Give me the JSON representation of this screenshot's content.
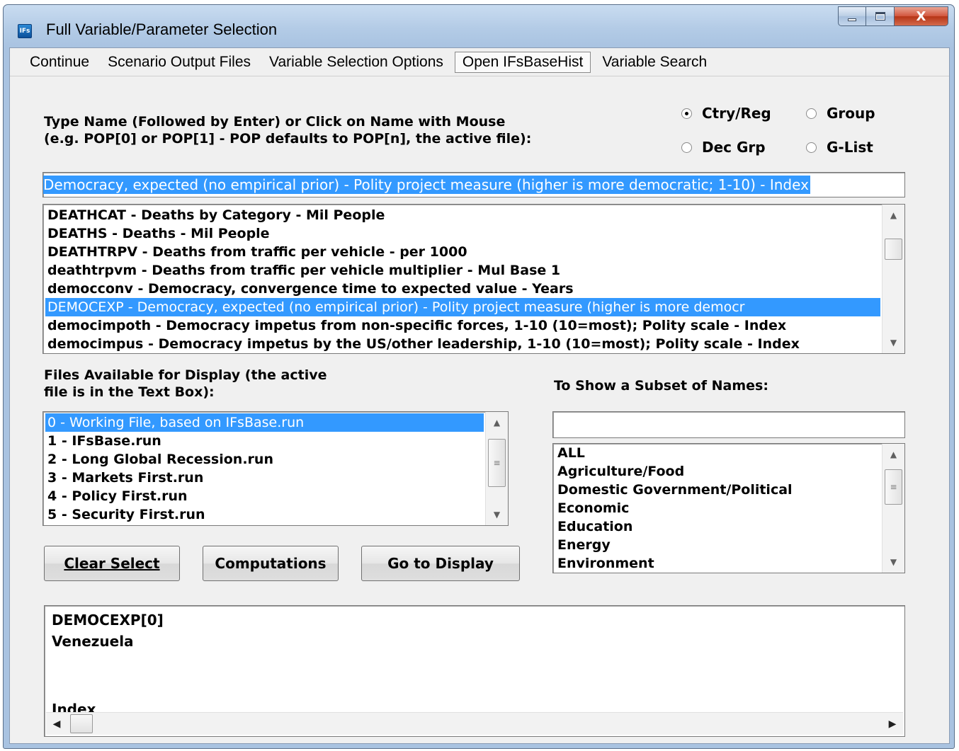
{
  "window": {
    "title": "Full Variable/Parameter Selection",
    "icon_label": "IFs",
    "close_glyph": "X"
  },
  "menu": {
    "items": [
      {
        "label": "Continue",
        "active": false
      },
      {
        "label": "Scenario Output Files",
        "active": false
      },
      {
        "label": "Variable Selection Options",
        "active": false
      },
      {
        "label": "Open IFsBaseHist",
        "active": true
      },
      {
        "label": "Variable Search",
        "active": false
      }
    ]
  },
  "instructions": {
    "line1": "Type Name (Followed by Enter) or Click on Name with Mouse",
    "line2": "(e.g. POP[0] or POP[1] - POP defaults to POP[n], the active file):"
  },
  "radios": {
    "ctry_reg": {
      "label": "Ctry/Reg",
      "checked": true
    },
    "group": {
      "label": "Group",
      "checked": false
    },
    "dec_grp": {
      "label": "Dec Grp",
      "checked": false
    },
    "g_list": {
      "label": "G-List",
      "checked": false
    }
  },
  "variable_input": {
    "value": "Democracy, expected (no empirical prior) - Polity project measure  (higher is more democratic; 1-10) - Index"
  },
  "variables": [
    {
      "text": "DEATHCAT - Deaths by Category - Mil People",
      "selected": false
    },
    {
      "text": "DEATHS - Deaths - Mil People",
      "selected": false
    },
    {
      "text": "DEATHTRPV - Deaths from traffic per vehicle - per 1000",
      "selected": false
    },
    {
      "text": "deathtrpvm - Deaths from traffic per vehicle multiplier - Mul Base 1",
      "selected": false
    },
    {
      "text": "democconv - Democracy, convergence time to expected value - Years",
      "selected": false
    },
    {
      "text": "DEMOCEXP - Democracy, expected (no empirical prior) - Polity project measure  (higher is more democr",
      "selected": true
    },
    {
      "text": "democimpoth - Democracy impetus from non-specific forces, 1-10 (10=most); Polity scale - Index",
      "selected": false
    },
    {
      "text": "democimpus - Democracy impetus by the US/other leadership, 1-10 (10=most); Polity scale - Index",
      "selected": false
    }
  ],
  "files_section": {
    "label_line1": "Files Available for Display (the active",
    "label_line2": "file is in the Text Box):",
    "items": [
      {
        "text": "0 - Working File, based on IFsBase.run",
        "selected": true
      },
      {
        "text": "1 - IFsBase.run",
        "selected": false
      },
      {
        "text": "2 - Long Global Recession.run",
        "selected": false
      },
      {
        "text": "3 - Markets First.run",
        "selected": false
      },
      {
        "text": "4 - Policy First.run",
        "selected": false
      },
      {
        "text": "5 - Security First.run",
        "selected": false
      }
    ]
  },
  "subset_section": {
    "label": "To Show a Subset of Names:",
    "filter_value": "",
    "items": [
      "ALL",
      "Agriculture/Food",
      "Domestic Government/Political",
      "Economic",
      "Education",
      "Energy",
      "Environment"
    ]
  },
  "buttons": {
    "clear_select": "Clear Select",
    "computations": "Computations",
    "go_to_display": "Go to Display"
  },
  "output": {
    "line1": "DEMOCEXP[0]",
    "line2": "Venezuela",
    "line3": "Index"
  },
  "icons": {
    "scroll_up": "▲",
    "scroll_down": "▼",
    "scroll_left": "◀",
    "scroll_right": "▶",
    "thumb_grip": "≡"
  }
}
